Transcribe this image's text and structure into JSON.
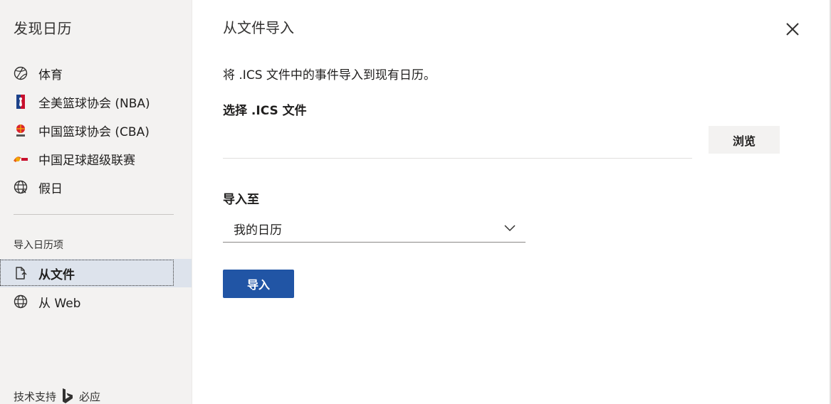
{
  "sidebar": {
    "title": "发现日历",
    "items": [
      {
        "label": "体育",
        "icon": "sports-ball-icon"
      },
      {
        "label": "全美篮球协会 (NBA)",
        "icon": "nba-logo-icon"
      },
      {
        "label": "中国篮球协会 (CBA)",
        "icon": "cba-logo-icon"
      },
      {
        "label": "中国足球超级联赛",
        "icon": "csl-logo-icon"
      },
      {
        "label": "假日",
        "icon": "globe-icon"
      }
    ],
    "section_label": "导入日历项",
    "import_items": [
      {
        "label": "从文件",
        "icon": "file-import-icon",
        "selected": true
      },
      {
        "label": "从 Web",
        "icon": "globe-icon",
        "selected": false
      }
    ],
    "footer": {
      "prefix": "技术支持",
      "brand": "必应"
    }
  },
  "main": {
    "title": "从文件导入",
    "description": "将 .ICS 文件中的事件导入到现有日历。",
    "choose_label": "选择 .ICS 文件",
    "file_value": "",
    "browse_label": "浏览",
    "import_to_label": "导入至",
    "selected_calendar": "我的日历",
    "import_button": "导入"
  },
  "colors": {
    "accent": "#2155a5",
    "sidebar_bg": "#f3f2f1",
    "selected_bg": "#dde3ec"
  }
}
